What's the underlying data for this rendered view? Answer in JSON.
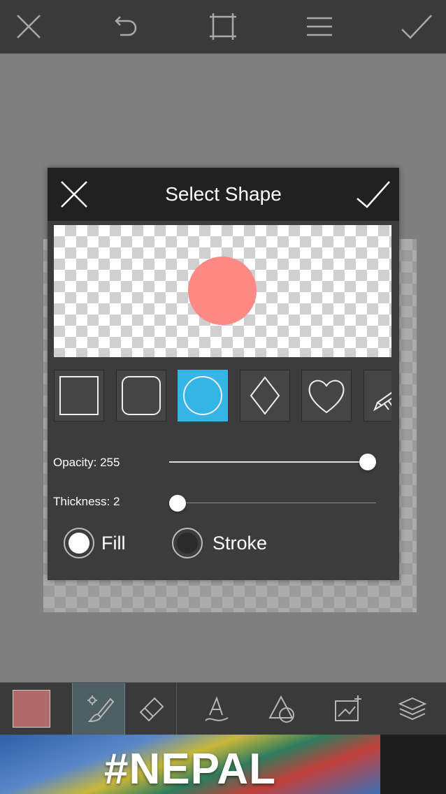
{
  "dialog": {
    "title": "Select Shape",
    "selected_shape": "circle",
    "shapes": [
      "square",
      "rounded-square",
      "circle",
      "diamond",
      "heart",
      "custom"
    ],
    "preview_color": "#ff8a85",
    "opacity_label": "Opacity: 255",
    "opacity_value": 255,
    "thickness_label": "Thickness: 2",
    "thickness_value": 2,
    "fill_label": "Fill",
    "stroke_label": "Stroke",
    "selected_mode": "Fill"
  },
  "colors": {
    "accent": "#35b5e5",
    "current_color": "#b06a6a"
  },
  "ad": {
    "text": "#NEPAL"
  },
  "icons": {
    "top": [
      "close-icon",
      "undo-icon",
      "crop-frame-icon",
      "menu-icon",
      "checkmark-icon"
    ],
    "bottom": [
      "color-swatch",
      "brush-icon",
      "eraser-icon",
      "text-icon",
      "shapes-icon",
      "add-image-icon",
      "layers-icon"
    ]
  }
}
